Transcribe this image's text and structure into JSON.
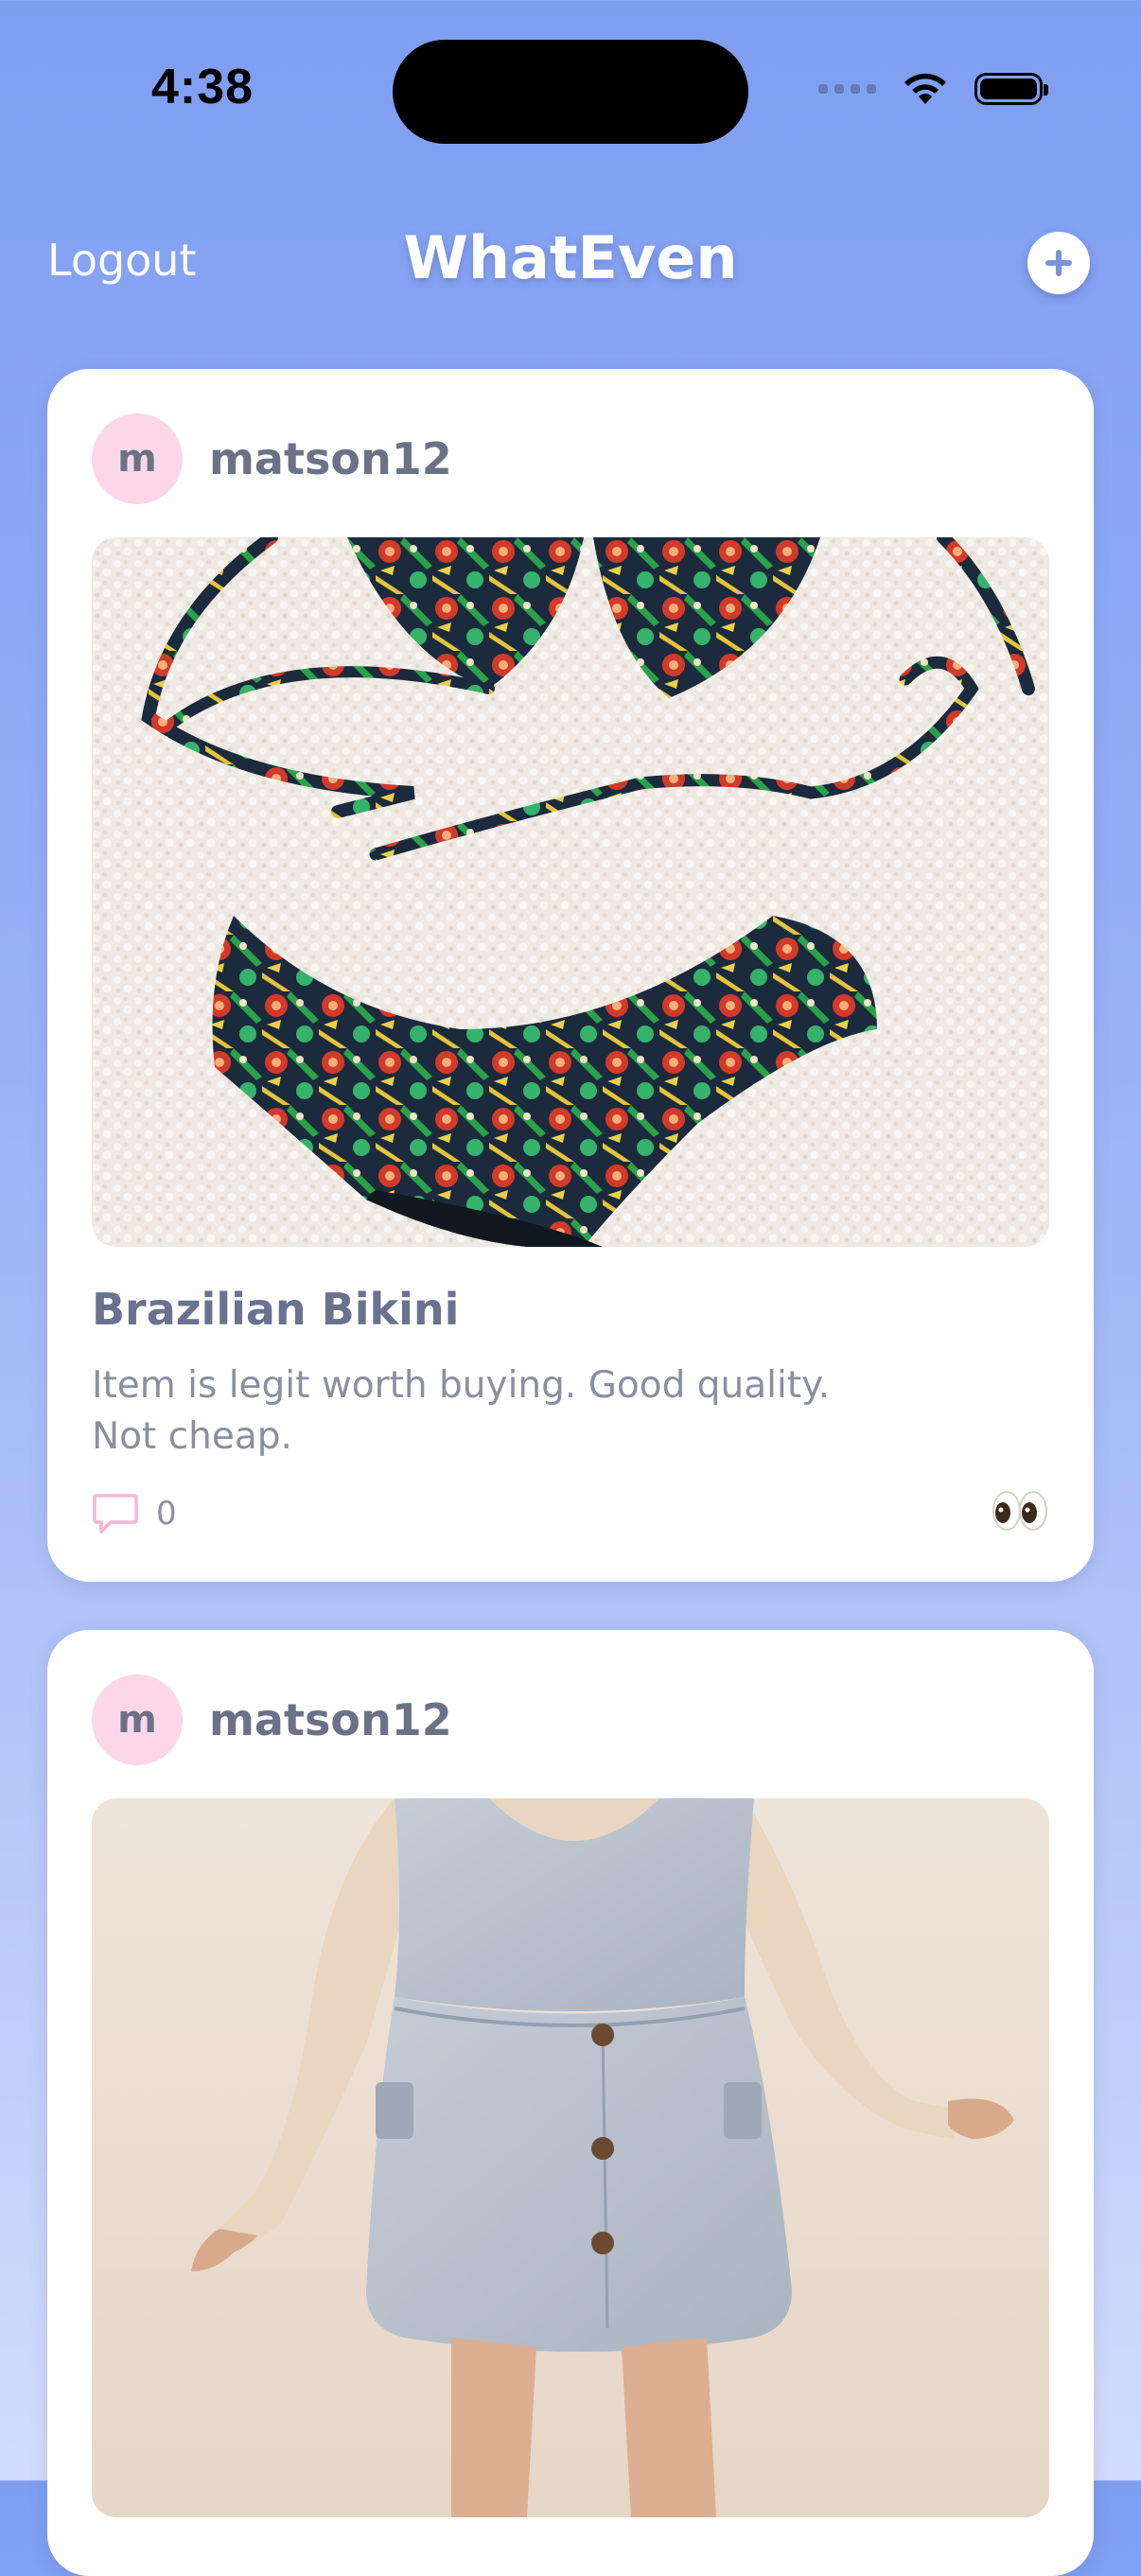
{
  "status_bar": {
    "time": "4:38"
  },
  "nav": {
    "logout_label": "Logout",
    "title": "WhatEven",
    "add_icon": "plus-icon"
  },
  "posts": [
    {
      "avatar_initial": "m",
      "username": "matson12",
      "image_subject": "floral-bikini",
      "title": "Brazilian Bikini",
      "description_line1": "Item is legit worth buying.  Good quality.",
      "description_line2": "Not cheap.",
      "comment_count": "0",
      "reaction_icon": "eyes-icon"
    },
    {
      "avatar_initial": "m",
      "username": "matson12",
      "image_subject": "denim-dress"
    }
  ],
  "colors": {
    "background_top": "#7f9ef2",
    "background_bottom": "#d2dcfb",
    "avatar_bg": "#fcd7e8",
    "comment_icon": "#f7b6d2",
    "text_muted": "#8a8fa0",
    "text_title": "#6a7290"
  }
}
